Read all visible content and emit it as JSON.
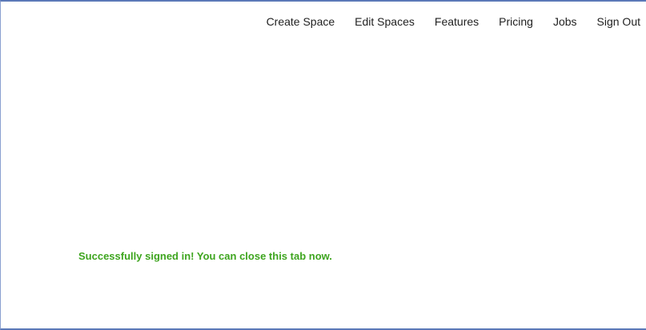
{
  "nav": {
    "items": [
      {
        "label": "Create Space"
      },
      {
        "label": "Edit Spaces"
      },
      {
        "label": "Features"
      },
      {
        "label": "Pricing"
      },
      {
        "label": "Jobs"
      },
      {
        "label": "Sign Out"
      }
    ]
  },
  "main": {
    "success_message": "Successfully signed in! You can close this tab now."
  },
  "colors": {
    "success": "#3ea51f",
    "frame_border": "#5b79b8",
    "nav_text": "#222222"
  }
}
